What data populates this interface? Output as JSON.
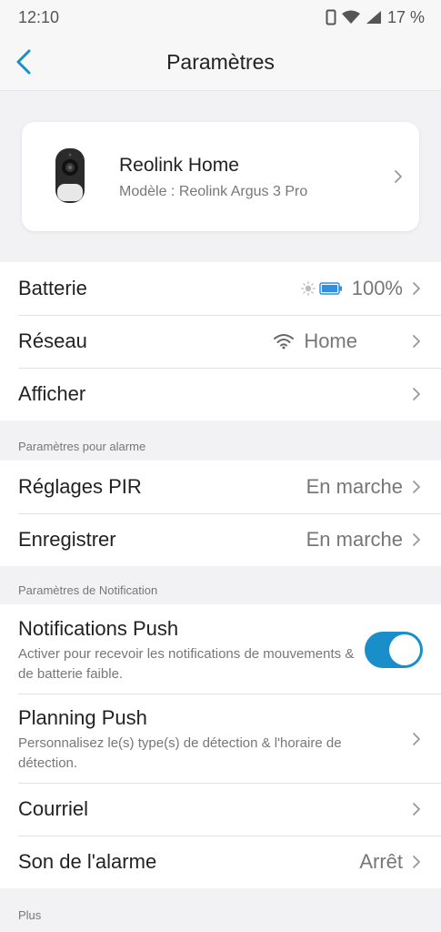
{
  "status_bar": {
    "time": "12:10",
    "battery": "17 %"
  },
  "header": {
    "title": "Paramètres"
  },
  "device": {
    "name": "Reolink Home",
    "model": "Modèle : Reolink Argus 3 Pro"
  },
  "main_group": {
    "battery_label": "Batterie",
    "battery_value": "100%",
    "network_label": "Réseau",
    "network_value": "Home",
    "display_label": "Afficher"
  },
  "alarm_section": {
    "header": "Paramètres pour alarme",
    "pir_label": "Réglages PIR",
    "pir_value": "En marche",
    "record_label": "Enregistrer",
    "record_value": "En marche"
  },
  "notification_section": {
    "header": "Paramètres de Notification",
    "push_label": "Notifications Push",
    "push_desc": "Activer pour recevoir les notifications de mouvements & de batterie faible.",
    "push_enabled": true,
    "schedule_label": "Planning Push",
    "schedule_desc": "Personnalisez le(s) type(s) de détection & l'horaire de détection.",
    "email_label": "Courriel",
    "alarm_sound_label": "Son de l'alarme",
    "alarm_sound_value": "Arrêt"
  },
  "more_section": {
    "header": "Plus"
  },
  "colors": {
    "accent": "#1a8ec8",
    "background": "#f2f2f4",
    "battery_fill": "#2f8fe0"
  },
  "icons": {
    "back": "chevron-left-icon",
    "chevron": "chevron-right-icon",
    "wifi": "wifi-icon",
    "battery": "battery-icon",
    "sun": "sun-icon"
  }
}
